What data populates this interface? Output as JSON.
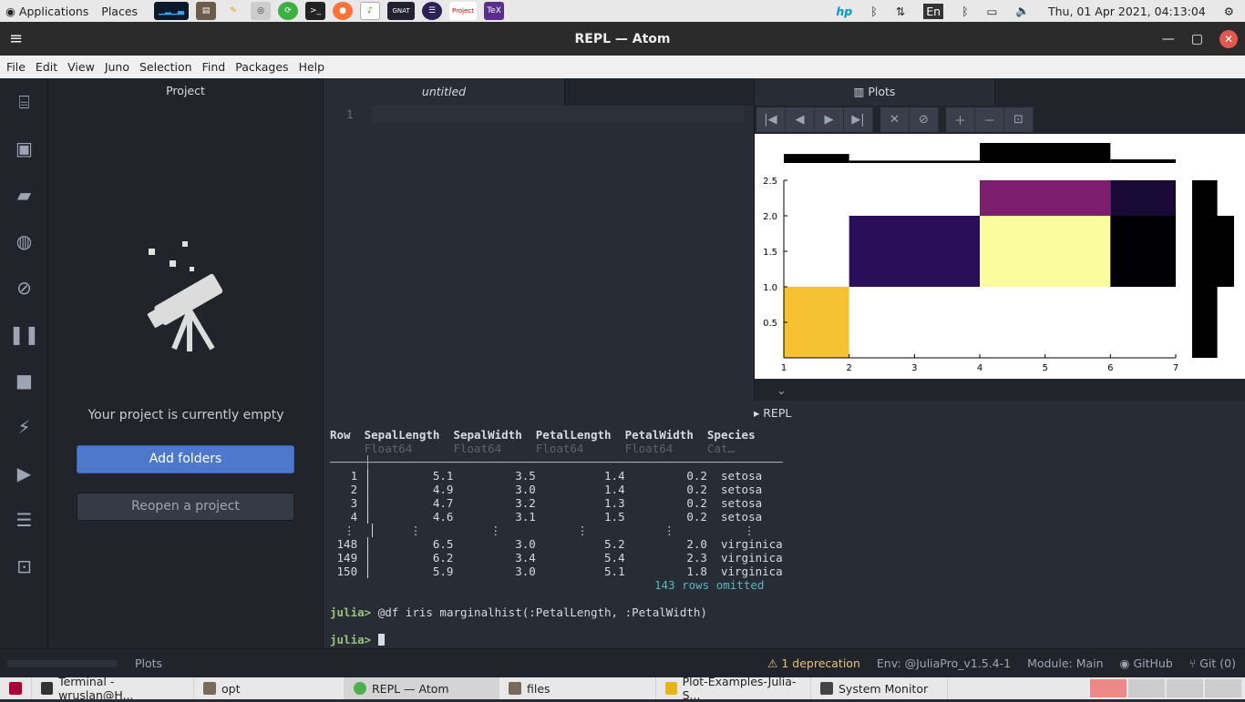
{
  "topbar": {
    "applications": "Applications",
    "places": "Places",
    "datetime": "Thu, 01 Apr 2021, 04:13:04",
    "lang": "En",
    "launchers": [
      "system-monitor",
      "file-manager",
      "text-editor",
      "screenshot",
      "update-manager",
      "terminal",
      "firefox",
      "libreoffice",
      "gnat-studio",
      "eclipse",
      "projectlibre",
      "texmaker"
    ],
    "tray": [
      "hp-icon",
      "bluetooth-icon",
      "network-icon",
      "bluetooth-icon",
      "battery-icon",
      "volume-icon",
      "power-icon"
    ]
  },
  "window": {
    "title": "REPL — Atom"
  },
  "menu": [
    "File",
    "Edit",
    "View",
    "Juno",
    "Selection",
    "Find",
    "Packages",
    "Help"
  ],
  "project": {
    "header": "Project",
    "empty_text": "Your project is currently empty",
    "add_folders": "Add folders",
    "reopen": "Reopen a project"
  },
  "editor": {
    "tab": "untitled",
    "line_number": "1"
  },
  "plots": {
    "tab": "Plots",
    "repl_tab": "REPL"
  },
  "chart_data": {
    "type": "heatmap",
    "title": "",
    "xlabel": "",
    "ylabel": "",
    "x_ticks": [
      "1",
      "2",
      "3",
      "4",
      "5",
      "6",
      "7"
    ],
    "y_ticks": [
      "0.5",
      "1.0",
      "1.5",
      "2.0",
      "2.5"
    ],
    "xlim": [
      1,
      7
    ],
    "ylim": [
      0,
      2.5
    ],
    "cells": [
      {
        "x0": 1,
        "x1": 2,
        "y0": 0,
        "y1": 1.0,
        "color": "#f7c134"
      },
      {
        "x0": 2,
        "x1": 4,
        "y0": 1.0,
        "y1": 2.0,
        "color": "#2a0e5a"
      },
      {
        "x0": 4,
        "x1": 6,
        "y0": 1.0,
        "y1": 2.0,
        "color": "#fbfc9e"
      },
      {
        "x0": 6,
        "x1": 7,
        "y0": 1.0,
        "y1": 2.0,
        "color": "#000004"
      },
      {
        "x0": 4,
        "x1": 6,
        "y0": 2.0,
        "y1": 2.5,
        "color": "#7d1f6e"
      },
      {
        "x0": 6,
        "x1": 7,
        "y0": 2.0,
        "y1": 2.5,
        "color": "#1a0a36"
      }
    ],
    "top_hist": [
      {
        "x0": 1,
        "x1": 2,
        "h": 0.45
      },
      {
        "x0": 2,
        "x1": 4,
        "h": 0.12
      },
      {
        "x0": 4,
        "x1": 6,
        "h": 1.0
      },
      {
        "x0": 6,
        "x1": 7,
        "h": 0.18
      }
    ],
    "right_hist": [
      {
        "y0": 0,
        "y1": 1.0,
        "w": 0.6
      },
      {
        "y0": 1.0,
        "y1": 2.0,
        "w": 1.0
      },
      {
        "y0": 2.0,
        "y1": 2.5,
        "w": 0.6
      }
    ]
  },
  "repl": {
    "header_row": "Row  SepalLength  SepalWidth  PetalLength  PetalWidth  Species",
    "types_row": "     Float64      Float64     Float64      Float64     Cat…",
    "separator": "─────┼────────────────────────────────────────────────────────────",
    "rows": [
      "   1 │         5.1         3.5          1.4         0.2  setosa",
      "   2 │         4.9         3.0          1.4         0.2  setosa",
      "   3 │         4.7         3.2          1.3         0.2  setosa",
      "   4 │         4.6         3.1          1.5         0.2  setosa",
      "  ⋮  │     ⋮          ⋮           ⋮           ⋮          ⋮",
      " 148 │         6.5         3.0          5.2         2.0  virginica",
      " 149 │         6.2         3.4          5.4         2.3  virginica",
      " 150 │         5.9         3.0          5.1         1.8  virginica"
    ],
    "omitted": "143 rows omitted",
    "prompt": "julia>",
    "command": "@df iris marginalhist(:PetalLength, :PetalWidth)"
  },
  "status": {
    "plots": "Plots",
    "deprecation": "1 deprecation",
    "env": "Env: @JuliaPro_v1.5.4-1",
    "module": "Module: Main",
    "github": "GitHub",
    "git": "Git (0)"
  },
  "taskbar": [
    {
      "label": "Terminal - wruslan@H...",
      "color": "#333333"
    },
    {
      "label": "opt",
      "color": "#7a6a5a"
    },
    {
      "label": "REPL — Atom",
      "color": "#4caf50",
      "active": true
    },
    {
      "label": "files",
      "color": "#7a6a5a"
    },
    {
      "label": "Plot-Examples-Julia-S...",
      "color": "#e2b714"
    },
    {
      "label": "System Monitor",
      "color": "#444444"
    }
  ]
}
